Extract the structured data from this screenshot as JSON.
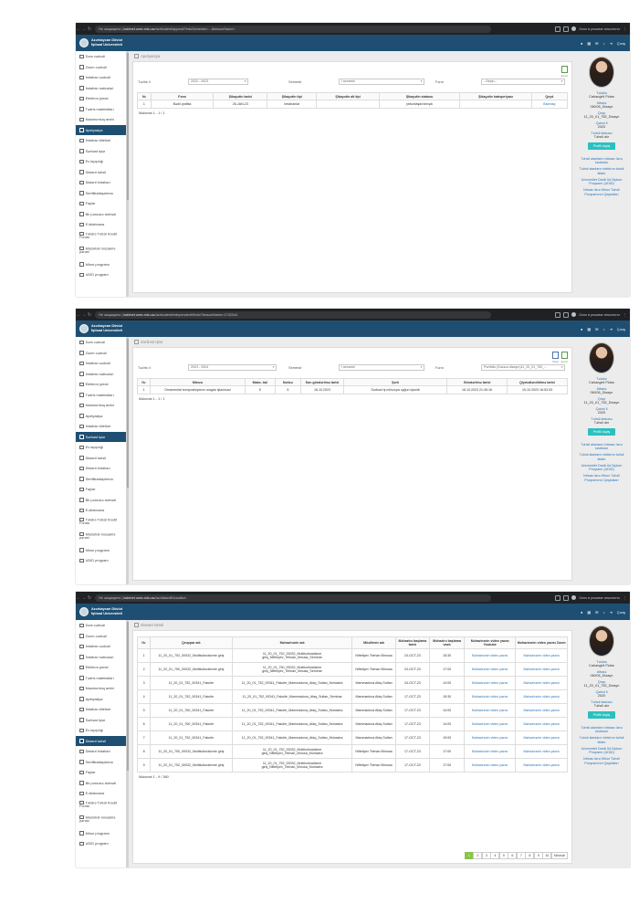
{
  "brand": {
    "line1": "Azərbaycan Dövlət",
    "line2": "İqtisad Universiteti"
  },
  "browser": {
    "incognito": "Окно в режиме инкогнито",
    "secure": "Не защищено",
    "host": "kabinet.unec.edu.az"
  },
  "header": {
    "exit": "Çıxış"
  },
  "sidebar": [
    "Dərs cədvəli",
    "Zoom cədvəli",
    "İmtahan cədvəli",
    "İmtahan nəticələri",
    "Elektron jurnal",
    "Tədris materialları",
    "Məsmumluq arxivi",
    "Apelyasiya",
    "İmtahan biletləri",
    "Sərbəst işlər",
    "Ev tapşırığı",
    "Distant təhsil",
    "Distant imtahan",
    "Sertifikatlaşdırma",
    "Faylar",
    "Bir pəncərə xidməti",
    "E-kitabxana",
    "Tələbə Təhsil Kredit Fondu",
    "Məsləhət-məzakirə pərəsi",
    "Minor programı",
    "UDİD program"
  ],
  "profile": {
    "role": "Tələbə",
    "name": "Cahangirli Fidan",
    "id_label": "İdbarə",
    "id_value": "06X06_Dizayn",
    "group_label": "Qrup",
    "group_value": "11_20_01_752_Dizayn",
    "year_label": "Qəbul il",
    "year_value": "2020",
    "status_label": "Təhsil statusu",
    "status_value": "Təhsil alır",
    "btn": "Profili dəyiş",
    "links": [
      "Təhsil alanların ixtisası üzrə tələbələr",
      "Təhsil alanların elektron təhsil kitabı",
      "Universitet Daxili İkt Diplom Proqramı (UDİD)",
      "İxtisas üzrə Minor Təhsil Proqramının Qaydaları"
    ]
  },
  "shot1": {
    "url_path": "/az/student/appeal/?eduSemester=...&lessonName=",
    "active_index": 7,
    "page_title": "Apelyasiya",
    "filters": {
      "year_label": "Tədris il",
      "year_value": "2022 - 2023",
      "semester_label": "Semestr",
      "semester_value": "I semestr",
      "subject_label": "Fənn",
      "subject_value": "--Seçin--"
    },
    "export_label": "Excel",
    "headers": [
      "№",
      "Fənn",
      "Şikayətin tarixi",
      "Şikayətin tipi",
      "Şikayətin alt tipi",
      "Şikayətin statusu",
      "Şikayətin kateqoriyası",
      "Qeyd"
    ],
    "rows": [
      [
        "1",
        "Bədii qrafika",
        "26-JAN-23",
        "İmtahanlar",
        "",
        "yekunlaşdırılmışdı",
        "",
        "Baxmaq"
      ]
    ],
    "footer": "Məlumat 1 - 1 / 1"
  },
  "shot2": {
    "url_path": "/az/student/independentWork/?lessonName=1742044",
    "active_index": 9,
    "page_title": "Sərbəst işlər",
    "filters": {
      "year_label": "Tədris il",
      "year_value": "2023 - 2024",
      "semester_label": "Semestr",
      "semester_value": "I semestr",
      "subject_label": "Fənn",
      "subject_value": "Portfolio (Dərəcə dizaynı)11_20_01_752_..."
    },
    "export_labels": [
      "Stats",
      "Excel"
    ],
    "headers": [
      "№",
      "Mövzu",
      "Maks. bal",
      "Nəticə",
      "Son göndərilmə tarixi",
      "Şərh",
      "Göndərilmə tarixi",
      "Qiymətləndirilmə tarixi"
    ],
    "rows": [
      [
        "1",
        "Ornamental kompozisiyanın rəngdə işlənməsi",
        "5",
        "5",
        "16.10.2023",
        "Sərbəst iş mövzuya uyğun işlənib",
        "16.10.2023 21:45:16",
        "19.10.2023 16:53:33"
      ]
    ],
    "footer": "Məlumat 1 - 1 / 1"
  },
  "shot3": {
    "url_path": "/az/distantEducation",
    "active_index": 11,
    "page_title": "Distant təhsil",
    "headers": [
      "№",
      "Qruppar adı",
      "Məhazirənin adı",
      "Müəllimin adı",
      "Məhazirə başlama tarixi",
      "Məhazirə başlama vaxtı",
      "Məhazirənin video yazısı Youtube",
      "Məhazirənin video yazısı Zoom"
    ],
    "rows": [
      [
        "1",
        "11_20_01_752_00032_Multikulturalizme giriş",
        "11_20_01_752_00032_Multikulturalizme giriş_Nifteliyev_Telman_Ilimusa_Seminar",
        "Nifteliyev Telman İllimusa",
        "24-OCT-23",
        "15:30",
        "Məhazirənin video yazısı",
        "Məhazirənin video yazısı"
      ],
      [
        "2",
        "11_20_01_750_00032_Multikulturalizme giriş",
        "11_20_01_750_00032_Multikulturalizme giriş_Nifteliyev_Telman_Ilimusa_Seminar",
        "Nifteliyev Telman İllimusa",
        "24-OCT-23",
        "17:00",
        "Məhazirənin video yazısı",
        "Məhazirənin video yazısı"
      ],
      [
        "3",
        "11_20_01_752_00341_Fakulte",
        "11_20_01_752_00341_Fakulte_Mammadova_Afaq_Sultan_Muhazira",
        "Mammadova Afaq Sultan",
        "24-OCT-23",
        "14:00",
        "Məhazirənin video yazısı",
        "Məhazirənin video yazısı"
      ],
      [
        "4",
        "11_20_01_752_00341_Fakulte",
        "11_20_01_752_00341_Fakulte_Mammadova_Afaq_Sultan_Seminar",
        "Mammadova Afaq Sultan",
        "17-OCT-23",
        "15:30",
        "Məhazirənin video yazısı",
        "Məhazirənin video yazısı"
      ],
      [
        "5",
        "11_20_01_760_00341_Fakulte",
        "11_20_01_752_00341_Fakulte_Mammadova_Afaq_Sultan_Muhazira",
        "Mammadova Afaq Sultan",
        "17-OCT-23",
        "14:00",
        "Məhazirənin video yazısı",
        "Məhazirənin video yazısı"
      ],
      [
        "6",
        "11_20_01_760_00341_Fakulte",
        "11_20_01_752_00341_Fakulte_Mammadova_Afaq_Sultan_Muhazira",
        "Mammadova Afaq Sultan",
        "17-OCT-23",
        "14:00",
        "Məhazirənin video yazısı",
        "Məhazirənin video yazısı"
      ],
      [
        "7",
        "11_20_01_752_00341_Fakulte",
        "11_20_01_752_00341_Fakulte_Mammadova_Afaq_Sultan_Muhazira",
        "Mammadova Afaq Sultan",
        "17-OCT-23",
        "19:00",
        "Məhazirənin video yazısı",
        "Məhazirənin video yazısı"
      ],
      [
        "8",
        "11_20_01_750_00032_Multikulturalizme giriş",
        "11_20_01_752_00032_Multikulturalizme giriş_Nifteliyev_Telman_Ilimusa_Muhazira",
        "Nifteliyev Telman İllimusa",
        "17-OCT-23",
        "17:00",
        "Məhazirənin video yazısı",
        "Məhazirənin video yazısı"
      ],
      [
        "9",
        "11_20_01_752_00032_Multikulturalizme giriş",
        "11_20_01_752_00032_Multikulturalizme giriş_Nifteliyev_Telman_Ilimusa_Muhazira",
        "Nifteliyev Telman İllimusa",
        "17-OCT-23",
        "17:00",
        "Məhazirənin video yazısı",
        "Məhazirənin video yazısı"
      ]
    ],
    "footer": "Məlumat 1 - 9 / 380",
    "pager": [
      "1",
      "2",
      "3",
      "4",
      "5",
      "6",
      "7",
      "8",
      "9",
      "10",
      "Növbəti"
    ]
  }
}
